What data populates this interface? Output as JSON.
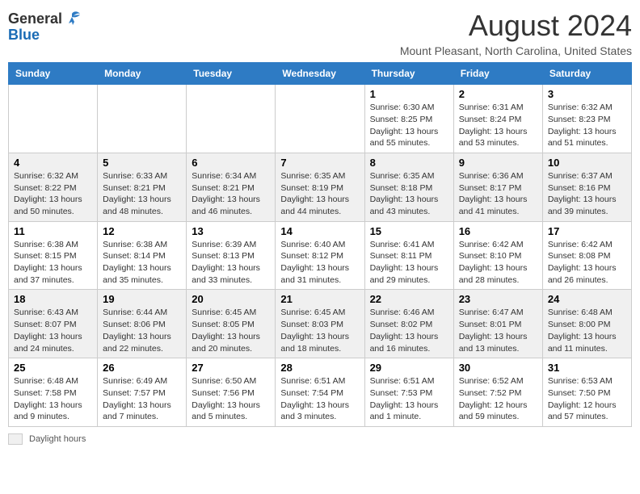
{
  "logo": {
    "general": "General",
    "blue": "Blue"
  },
  "title": "August 2024",
  "location": "Mount Pleasant, North Carolina, United States",
  "days_of_week": [
    "Sunday",
    "Monday",
    "Tuesday",
    "Wednesday",
    "Thursday",
    "Friday",
    "Saturday"
  ],
  "footer": {
    "label": "Daylight hours"
  },
  "weeks": [
    {
      "days": [
        {
          "number": "",
          "info": ""
        },
        {
          "number": "",
          "info": ""
        },
        {
          "number": "",
          "info": ""
        },
        {
          "number": "",
          "info": ""
        },
        {
          "number": "1",
          "info": "Sunrise: 6:30 AM\nSunset: 8:25 PM\nDaylight: 13 hours and 55 minutes."
        },
        {
          "number": "2",
          "info": "Sunrise: 6:31 AM\nSunset: 8:24 PM\nDaylight: 13 hours and 53 minutes."
        },
        {
          "number": "3",
          "info": "Sunrise: 6:32 AM\nSunset: 8:23 PM\nDaylight: 13 hours and 51 minutes."
        }
      ],
      "style": "white"
    },
    {
      "days": [
        {
          "number": "4",
          "info": "Sunrise: 6:32 AM\nSunset: 8:22 PM\nDaylight: 13 hours and 50 minutes."
        },
        {
          "number": "5",
          "info": "Sunrise: 6:33 AM\nSunset: 8:21 PM\nDaylight: 13 hours and 48 minutes."
        },
        {
          "number": "6",
          "info": "Sunrise: 6:34 AM\nSunset: 8:21 PM\nDaylight: 13 hours and 46 minutes."
        },
        {
          "number": "7",
          "info": "Sunrise: 6:35 AM\nSunset: 8:19 PM\nDaylight: 13 hours and 44 minutes."
        },
        {
          "number": "8",
          "info": "Sunrise: 6:35 AM\nSunset: 8:18 PM\nDaylight: 13 hours and 43 minutes."
        },
        {
          "number": "9",
          "info": "Sunrise: 6:36 AM\nSunset: 8:17 PM\nDaylight: 13 hours and 41 minutes."
        },
        {
          "number": "10",
          "info": "Sunrise: 6:37 AM\nSunset: 8:16 PM\nDaylight: 13 hours and 39 minutes."
        }
      ],
      "style": "gray"
    },
    {
      "days": [
        {
          "number": "11",
          "info": "Sunrise: 6:38 AM\nSunset: 8:15 PM\nDaylight: 13 hours and 37 minutes."
        },
        {
          "number": "12",
          "info": "Sunrise: 6:38 AM\nSunset: 8:14 PM\nDaylight: 13 hours and 35 minutes."
        },
        {
          "number": "13",
          "info": "Sunrise: 6:39 AM\nSunset: 8:13 PM\nDaylight: 13 hours and 33 minutes."
        },
        {
          "number": "14",
          "info": "Sunrise: 6:40 AM\nSunset: 8:12 PM\nDaylight: 13 hours and 31 minutes."
        },
        {
          "number": "15",
          "info": "Sunrise: 6:41 AM\nSunset: 8:11 PM\nDaylight: 13 hours and 29 minutes."
        },
        {
          "number": "16",
          "info": "Sunrise: 6:42 AM\nSunset: 8:10 PM\nDaylight: 13 hours and 28 minutes."
        },
        {
          "number": "17",
          "info": "Sunrise: 6:42 AM\nSunset: 8:08 PM\nDaylight: 13 hours and 26 minutes."
        }
      ],
      "style": "white"
    },
    {
      "days": [
        {
          "number": "18",
          "info": "Sunrise: 6:43 AM\nSunset: 8:07 PM\nDaylight: 13 hours and 24 minutes."
        },
        {
          "number": "19",
          "info": "Sunrise: 6:44 AM\nSunset: 8:06 PM\nDaylight: 13 hours and 22 minutes."
        },
        {
          "number": "20",
          "info": "Sunrise: 6:45 AM\nSunset: 8:05 PM\nDaylight: 13 hours and 20 minutes."
        },
        {
          "number": "21",
          "info": "Sunrise: 6:45 AM\nSunset: 8:03 PM\nDaylight: 13 hours and 18 minutes."
        },
        {
          "number": "22",
          "info": "Sunrise: 6:46 AM\nSunset: 8:02 PM\nDaylight: 13 hours and 16 minutes."
        },
        {
          "number": "23",
          "info": "Sunrise: 6:47 AM\nSunset: 8:01 PM\nDaylight: 13 hours and 13 minutes."
        },
        {
          "number": "24",
          "info": "Sunrise: 6:48 AM\nSunset: 8:00 PM\nDaylight: 13 hours and 11 minutes."
        }
      ],
      "style": "gray"
    },
    {
      "days": [
        {
          "number": "25",
          "info": "Sunrise: 6:48 AM\nSunset: 7:58 PM\nDaylight: 13 hours and 9 minutes."
        },
        {
          "number": "26",
          "info": "Sunrise: 6:49 AM\nSunset: 7:57 PM\nDaylight: 13 hours and 7 minutes."
        },
        {
          "number": "27",
          "info": "Sunrise: 6:50 AM\nSunset: 7:56 PM\nDaylight: 13 hours and 5 minutes."
        },
        {
          "number": "28",
          "info": "Sunrise: 6:51 AM\nSunset: 7:54 PM\nDaylight: 13 hours and 3 minutes."
        },
        {
          "number": "29",
          "info": "Sunrise: 6:51 AM\nSunset: 7:53 PM\nDaylight: 13 hours and 1 minute."
        },
        {
          "number": "30",
          "info": "Sunrise: 6:52 AM\nSunset: 7:52 PM\nDaylight: 12 hours and 59 minutes."
        },
        {
          "number": "31",
          "info": "Sunrise: 6:53 AM\nSunset: 7:50 PM\nDaylight: 12 hours and 57 minutes."
        }
      ],
      "style": "white"
    }
  ]
}
